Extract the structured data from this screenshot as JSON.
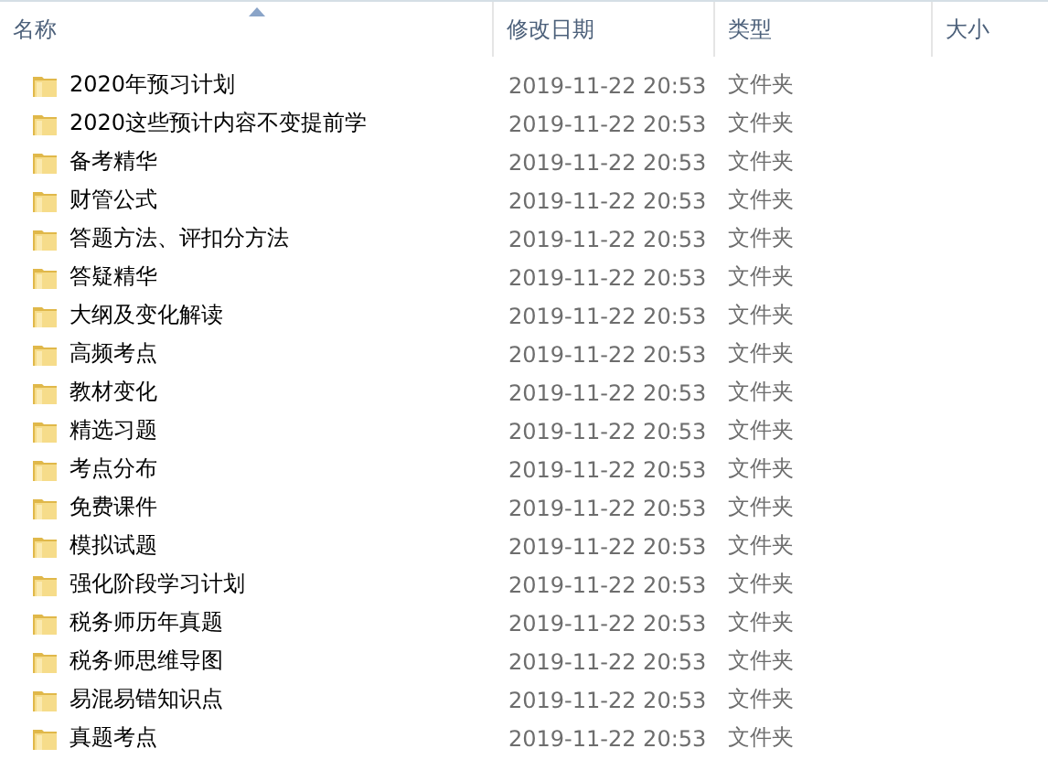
{
  "columns": [
    {
      "label": "名称",
      "sorted": true
    },
    {
      "label": "修改日期",
      "sorted": false
    },
    {
      "label": "类型",
      "sorted": false
    },
    {
      "label": "大小",
      "sorted": false
    }
  ],
  "rows": [
    {
      "name": "2020年预习计划",
      "modified": "2019-11-22 20:53",
      "type": "文件夹"
    },
    {
      "name": "2020这些预计内容不变提前学",
      "modified": "2019-11-22 20:53",
      "type": "文件夹"
    },
    {
      "name": "备考精华",
      "modified": "2019-11-22 20:53",
      "type": "文件夹"
    },
    {
      "name": "财管公式",
      "modified": "2019-11-22 20:53",
      "type": "文件夹"
    },
    {
      "name": "答题方法、评扣分方法",
      "modified": "2019-11-22 20:53",
      "type": "文件夹"
    },
    {
      "name": "答疑精华",
      "modified": "2019-11-22 20:53",
      "type": "文件夹"
    },
    {
      "name": "大纲及变化解读",
      "modified": "2019-11-22 20:53",
      "type": "文件夹"
    },
    {
      "name": "高频考点",
      "modified": "2019-11-22 20:53",
      "type": "文件夹"
    },
    {
      "name": "教材变化",
      "modified": "2019-11-22 20:53",
      "type": "文件夹"
    },
    {
      "name": "精选习题",
      "modified": "2019-11-22 20:53",
      "type": "文件夹"
    },
    {
      "name": "考点分布",
      "modified": "2019-11-22 20:53",
      "type": "文件夹"
    },
    {
      "name": "免费课件",
      "modified": "2019-11-22 20:53",
      "type": "文件夹"
    },
    {
      "name": "模拟试题",
      "modified": "2019-11-22 20:53",
      "type": "文件夹"
    },
    {
      "name": "强化阶段学习计划",
      "modified": "2019-11-22 20:53",
      "type": "文件夹"
    },
    {
      "name": "税务师历年真题",
      "modified": "2019-11-22 20:53",
      "type": "文件夹"
    },
    {
      "name": "税务师思维导图",
      "modified": "2019-11-22 20:53",
      "type": "文件夹"
    },
    {
      "name": "易混易错知识点",
      "modified": "2019-11-22 20:53",
      "type": "文件夹"
    },
    {
      "name": "真题考点",
      "modified": "2019-11-22 20:53",
      "type": "文件夹"
    }
  ]
}
